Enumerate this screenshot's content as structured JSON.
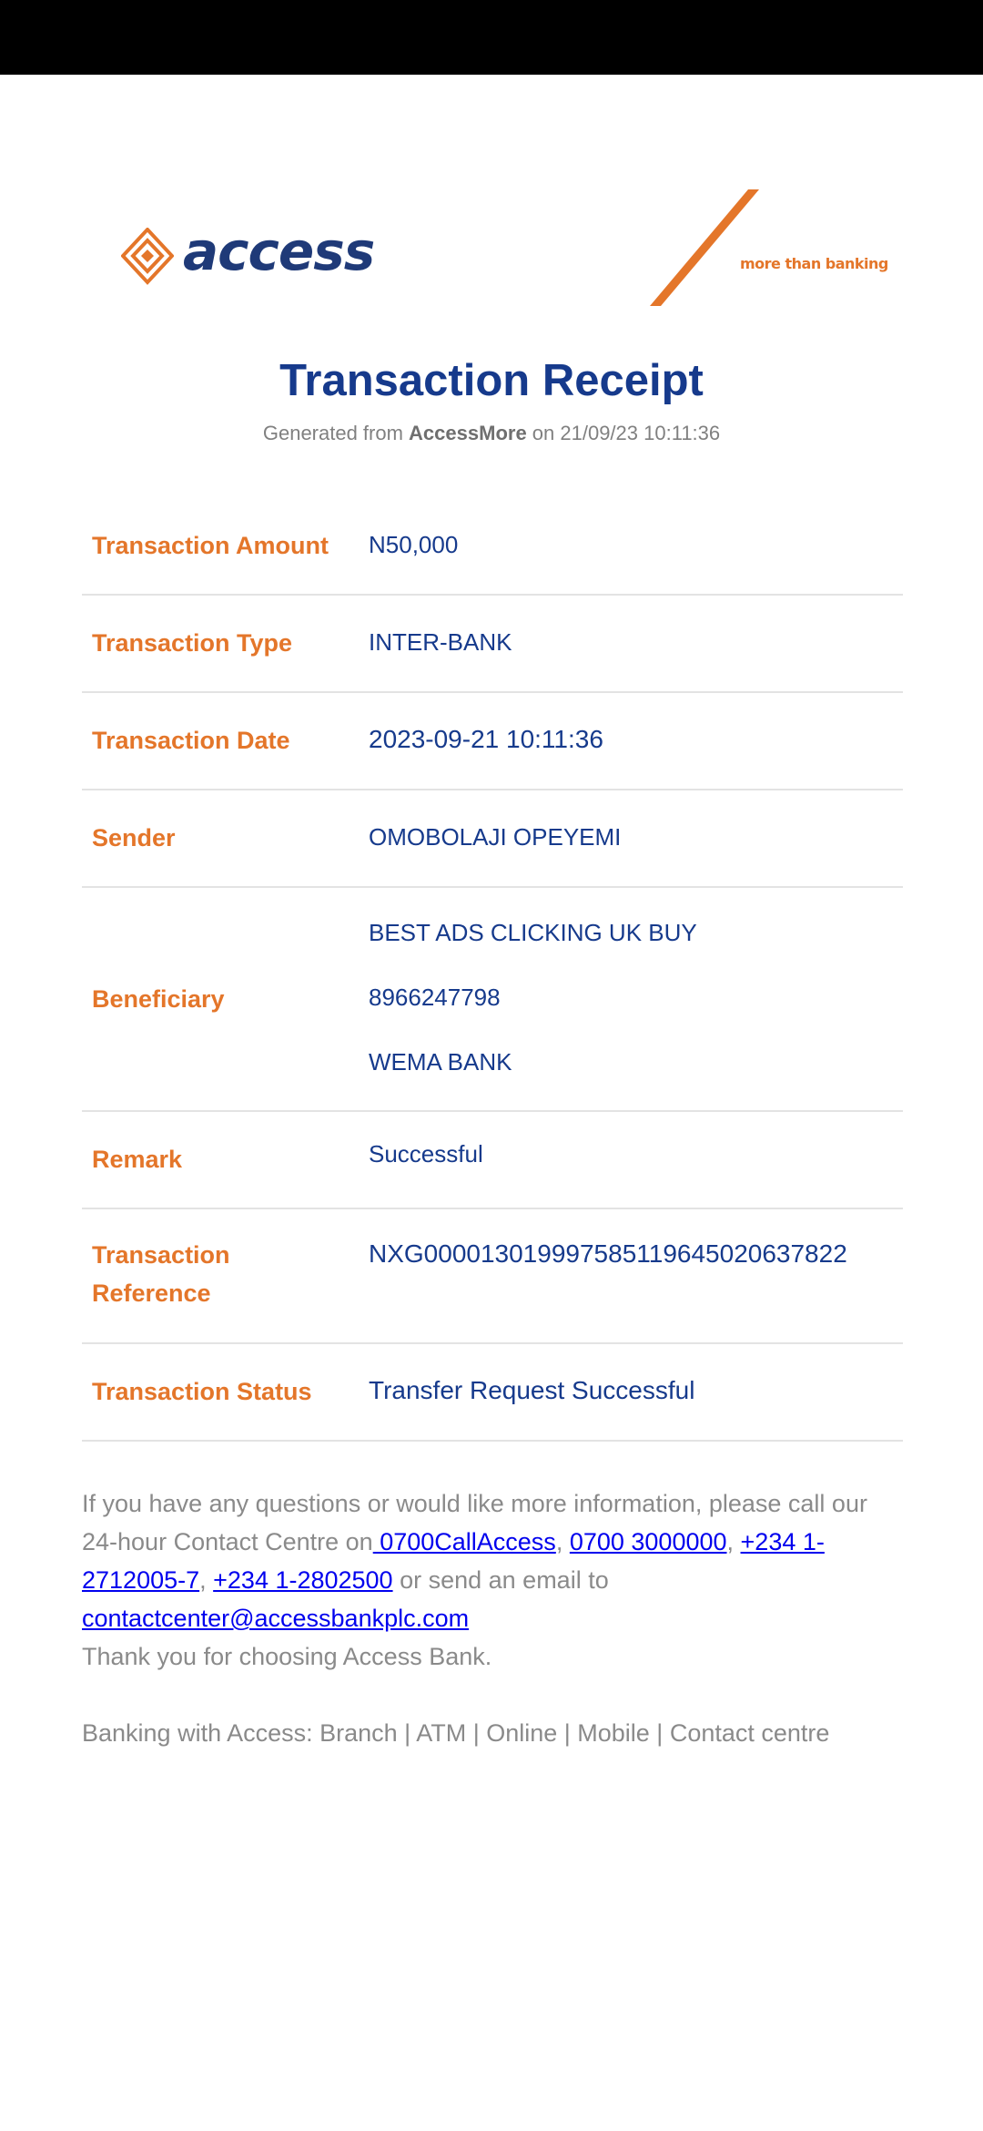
{
  "header": {
    "brand_name": "access",
    "tagline": "more than banking",
    "colors": {
      "brand_orange": "#e4762a",
      "brand_navy": "#1f3a78",
      "title_blue": "#163a8c"
    }
  },
  "receipt": {
    "title": "Transaction Receipt",
    "generated_prefix": "Generated from ",
    "generated_app": "AccessMore",
    "generated_suffix": " on 21/09/23 10:11:36",
    "rows": {
      "amount": {
        "label": "Transaction Amount",
        "value": "N50,000"
      },
      "type": {
        "label": "Transaction Type",
        "value": "INTER-BANK"
      },
      "date": {
        "label": "Transaction Date",
        "value": "2023-09-21 10:11:36"
      },
      "sender": {
        "label": "Sender",
        "value": "OMOBOLAJI OPEYEMI"
      },
      "beneficiary": {
        "label": "Beneficiary",
        "name": "BEST ADS CLICKING UK BUY",
        "account": "8966247798",
        "bank": "WEMA BANK"
      },
      "remark": {
        "label": "Remark",
        "value": "Successful"
      },
      "reference": {
        "label_line1": "Transaction",
        "label_line2": "Reference",
        "value": "NXG000013019997585119645020637822"
      },
      "status": {
        "label": "Transaction Status",
        "value": "Transfer Request Successful"
      }
    }
  },
  "footer": {
    "intro": "If you have any questions or would like more information, please call our 24-hour Contact Centre on",
    "link_1": " 0700CallAccess",
    "sep_1": ", ",
    "link_2": "0700 3000000",
    "sep_2": ", ",
    "link_3": "+234 1-2712005-7",
    "sep_3": ", ",
    "link_4": "+234 1-2802500",
    "email_prefix": " or send an email to ",
    "email": "contactcenter@accessbankplc.com",
    "thanks": "Thank you for choosing Access Bank.",
    "banking_with": "Banking with Access: Branch | ATM | Online | Mobile | Contact centre"
  }
}
